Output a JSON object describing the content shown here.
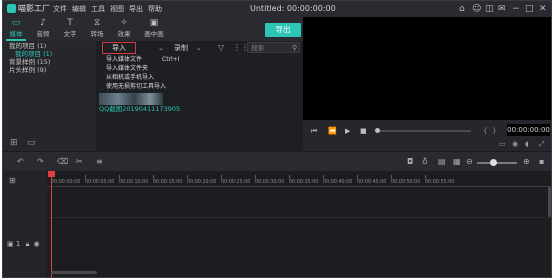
{
  "app": {
    "logo_text": "喵影工厂",
    "window_title": "Untitled: 00:00:00:00",
    "menu": [
      "文件",
      "编辑",
      "工具",
      "视图",
      "导出",
      "帮助"
    ],
    "top_icons": [
      "home-icon",
      "account-icon",
      "cart-icon",
      "mail-icon",
      "minimize-icon",
      "maximize-icon",
      "close-icon"
    ]
  },
  "toolbar": {
    "tabs": [
      {
        "label": "媒体",
        "icon": "folder-icon",
        "active": true
      },
      {
        "label": "音频",
        "icon": "music-icon",
        "active": false
      },
      {
        "label": "文字",
        "icon": "text-icon",
        "active": false
      },
      {
        "label": "转场",
        "icon": "transition-icon",
        "active": false
      },
      {
        "label": "效果",
        "icon": "effects-icon",
        "active": false
      },
      {
        "label": "画中画",
        "icon": "pip-icon",
        "active": false
      }
    ],
    "export_label": "导出"
  },
  "library": {
    "items": [
      {
        "label": "我的项目 (1)"
      },
      {
        "label": "我的项目 (1)",
        "selected": true
      },
      {
        "label": "背景样例 (15)"
      },
      {
        "label": "片头样例 (9)"
      }
    ],
    "bottom_icons": [
      "new-folder-icon",
      "folder-icon"
    ]
  },
  "media": {
    "import_label": "导入",
    "record_label": "录制",
    "search_placeholder": "搜索",
    "dropdown": [
      {
        "label": "导入媒体文件",
        "shortcut": "Ctrl+I"
      },
      {
        "label": "导入媒体文件夹",
        "shortcut": ""
      },
      {
        "label": "从相机或手机导入",
        "shortcut": ""
      },
      {
        "label": "使用无损剪切工具导入",
        "shortcut": ""
      }
    ],
    "clip_caption": "QQ截图20190411173905"
  },
  "preview": {
    "timecode": "00:00:00:00",
    "progress": 0
  },
  "timeline": {
    "ticks": [
      "00:00:00:00",
      "00:00:05:00",
      "00:00:10:00",
      "00:00:15:00",
      "00:00:20:00",
      "00:00:25:00",
      "00:00:30:00",
      "00:00:35:00",
      "00:00:40:00",
      "00:00:45:00",
      "00:00:50:00",
      "00:00:55:00"
    ],
    "track_label": "1"
  }
}
